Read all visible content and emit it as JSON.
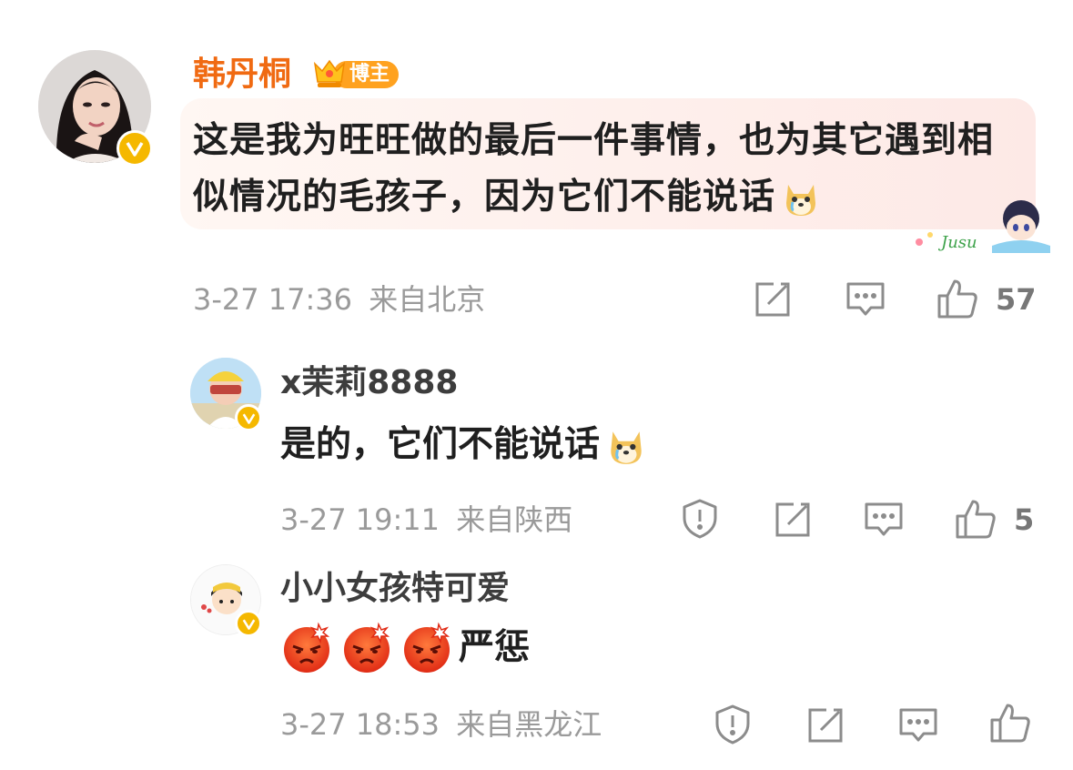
{
  "main_comment": {
    "username": "韩丹桐",
    "badge_label": "博主",
    "text": "这是我为旺旺做的最后一件事情，也为其它遇到相似情况的毛孩子，因为它们不能说话",
    "date": "3-27 17:36",
    "location": "来自北京",
    "likes": "57"
  },
  "replies": [
    {
      "username": "x茉莉8888",
      "text": "是的，它们不能说话",
      "date": "3-27 19:11",
      "location": "来自陕西",
      "likes": "5"
    },
    {
      "username": "小小女孩特可爱",
      "text": "严惩",
      "date": "3-27 18:53",
      "location": "来自黑龙江",
      "likes": ""
    }
  ],
  "colors": {
    "username_main": "#f06a12",
    "verified_badge": "#f5b800",
    "meta_text": "#9a9a9a",
    "icon_stroke": "#8c8c8c"
  },
  "icons": [
    "repost-icon",
    "comment-icon",
    "like-icon",
    "report-icon",
    "verified-badge-icon",
    "dog-tear-emoji",
    "angry-emoji"
  ]
}
